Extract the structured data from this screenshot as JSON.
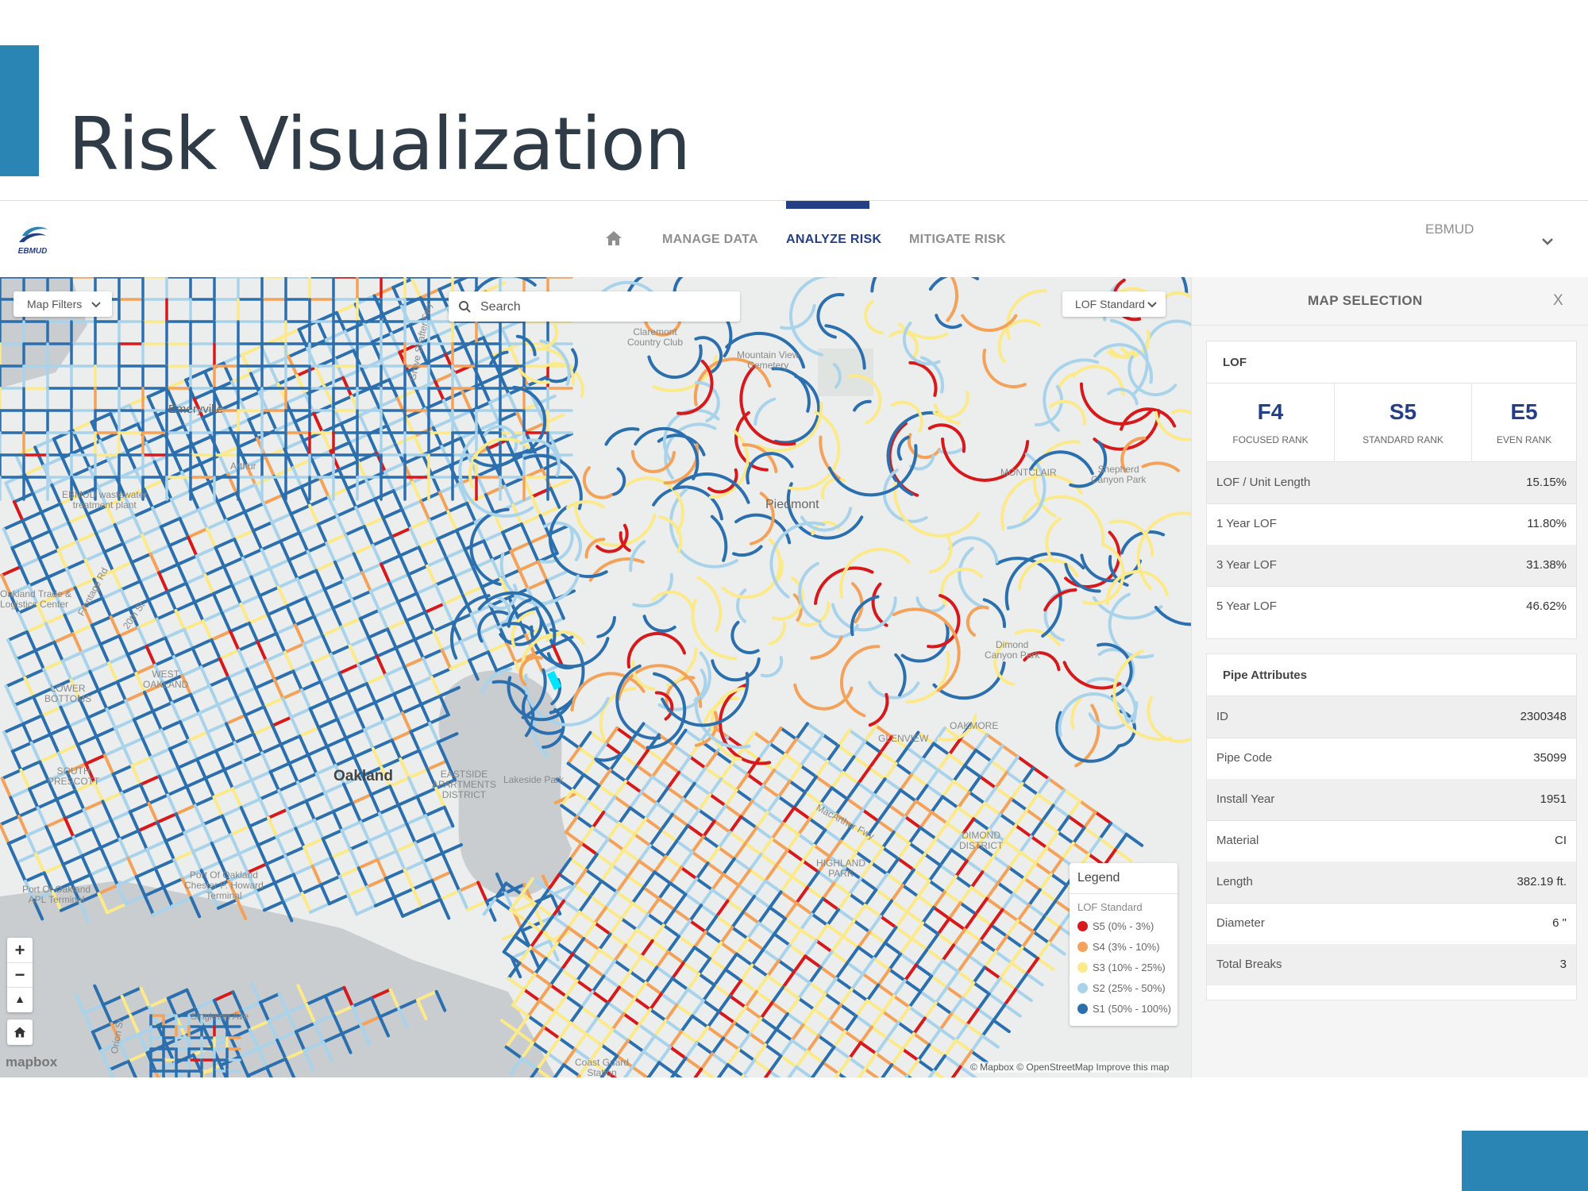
{
  "slide": {
    "title": "Risk Visualization"
  },
  "nav": {
    "items": [
      "MANAGE DATA",
      "ANALYZE RISK",
      "MITIGATE RISK"
    ],
    "active": "ANALYZE RISK",
    "user": "EBMUD",
    "logo_text": "EBMUD"
  },
  "map": {
    "filters_label": "Map Filters",
    "search_placeholder": "Search",
    "lof_select_value": "LOF Standard",
    "labels": {
      "claremont": "Claremont\nCountry Club",
      "mountain_view": "Mountain View\nCemetery",
      "piedmont": "Piedmont",
      "oakland": "Oakland",
      "emeryville": "Emeryville",
      "ebmud_plant": "EBMUD wastewater\ntreatment plant",
      "trade_center": "Oakland Trade &\nLogistics Center",
      "port_oakland_howard": "Port Of Oakland\nChester P. Howard\nTerminal",
      "port_apl": "Port Of Oakland\nAPL Terminal",
      "lakeside_park": "Lakeside Park",
      "dimond_park": "Dimond\nCanyon Park",
      "shepherd_park": "Shepherd\nCanyon Park",
      "coast_guard": "Coast Guard\nStation",
      "singleton": "Singleton Ave",
      "frontage": "Frontage Rd",
      "st20": "20th St",
      "orion": "Orion St",
      "grove_shafter": "Grove Shafter Fwy",
      "mac_arthur": "MacArthur Fwy",
      "arthur": "Arthur",
      "oakmore": "OAKMORE",
      "glenview": "GLENVIEW",
      "highland_park": "HIGHLAND\nPARK",
      "west_oakland": "WEST\nOAKLAND",
      "south_prescott": "SOUTH\nPRESCOTT",
      "lower_bottoms": "LOWER\nBOTTOMS",
      "eastlake": "EASTSIDE\nAPARTMENTS\nDISTRICT",
      "montclair": "MONTCLAIR",
      "dimond_district": "DIMOND\nDISTRICT"
    },
    "legend": {
      "title": "Legend",
      "subtitle": "LOF Standard",
      "items": [
        {
          "label": "S5 (0% - 3%)",
          "color": "#d7191c"
        },
        {
          "label": "S4 (3% - 10%)",
          "color": "#f4a259"
        },
        {
          "label": "S3 (10% - 25%)",
          "color": "#fbe98a"
        },
        {
          "label": "S2 (25% - 50%)",
          "color": "#a9d3ea"
        },
        {
          "label": "S1 (50% - 100%)",
          "color": "#2b6fae"
        }
      ]
    },
    "mapbox_logo": "mapbox",
    "attribution": "© Mapbox © OpenStreetMap Improve this map"
  },
  "panel": {
    "title": "MAP SELECTION",
    "close": "X",
    "lof": {
      "title": "LOF",
      "ranks": [
        {
          "value": "F4",
          "label": "FOCUSED RANK"
        },
        {
          "value": "S5",
          "label": "STANDARD RANK"
        },
        {
          "value": "E5",
          "label": "EVEN RANK"
        }
      ],
      "rows": [
        {
          "key": "LOF / Unit Length",
          "value": "15.15%"
        },
        {
          "key": "1 Year LOF",
          "value": "11.80%"
        },
        {
          "key": "3 Year LOF",
          "value": "31.38%"
        },
        {
          "key": "5 Year LOF",
          "value": "46.62%"
        }
      ]
    },
    "attributes": {
      "title": "Pipe Attributes",
      "rows": [
        {
          "key": "ID",
          "value": "2300348"
        },
        {
          "key": "Pipe Code",
          "value": "35099"
        },
        {
          "key": "Install Year",
          "value": "1951"
        },
        {
          "key": "Material",
          "value": "CI"
        },
        {
          "key": "Length",
          "value": "382.19 ft."
        },
        {
          "key": "Diameter",
          "value": "6 \""
        },
        {
          "key": "Total Breaks",
          "value": "3"
        }
      ]
    }
  }
}
